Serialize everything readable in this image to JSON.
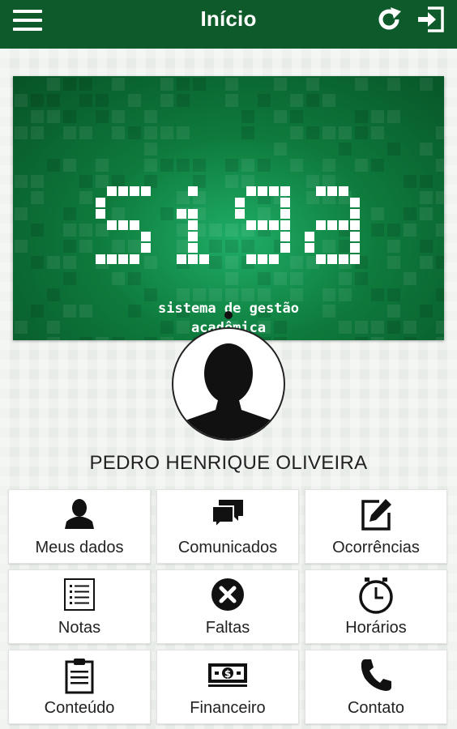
{
  "appbar": {
    "title": "Início",
    "menu_icon": "hamburger-menu-icon",
    "refresh_icon": "refresh-icon",
    "exit_icon": "sign-out-icon",
    "color": "#0f5a2a"
  },
  "banner": {
    "logo_text": "siga",
    "tagline_line1": "sistema de gestão",
    "tagline_line2": "acadêmica"
  },
  "profile": {
    "avatar_icon": "user-silhouette-icon",
    "name": "PEDRO HENRIQUE OLIVEIRA"
  },
  "tiles": [
    {
      "label": "Meus dados",
      "icon": "person-icon"
    },
    {
      "label": "Comunicados",
      "icon": "chat-bubbles-icon"
    },
    {
      "label": "Ocorrências",
      "icon": "edit-note-icon"
    },
    {
      "label": "Notas",
      "icon": "list-icon"
    },
    {
      "label": "Faltas",
      "icon": "close-circle-icon"
    },
    {
      "label": "Horários",
      "icon": "clock-icon"
    },
    {
      "label": "Conteúdo",
      "icon": "clipboard-icon"
    },
    {
      "label": "Financeiro",
      "icon": "money-bill-icon"
    },
    {
      "label": "Contato",
      "icon": "phone-icon"
    }
  ]
}
